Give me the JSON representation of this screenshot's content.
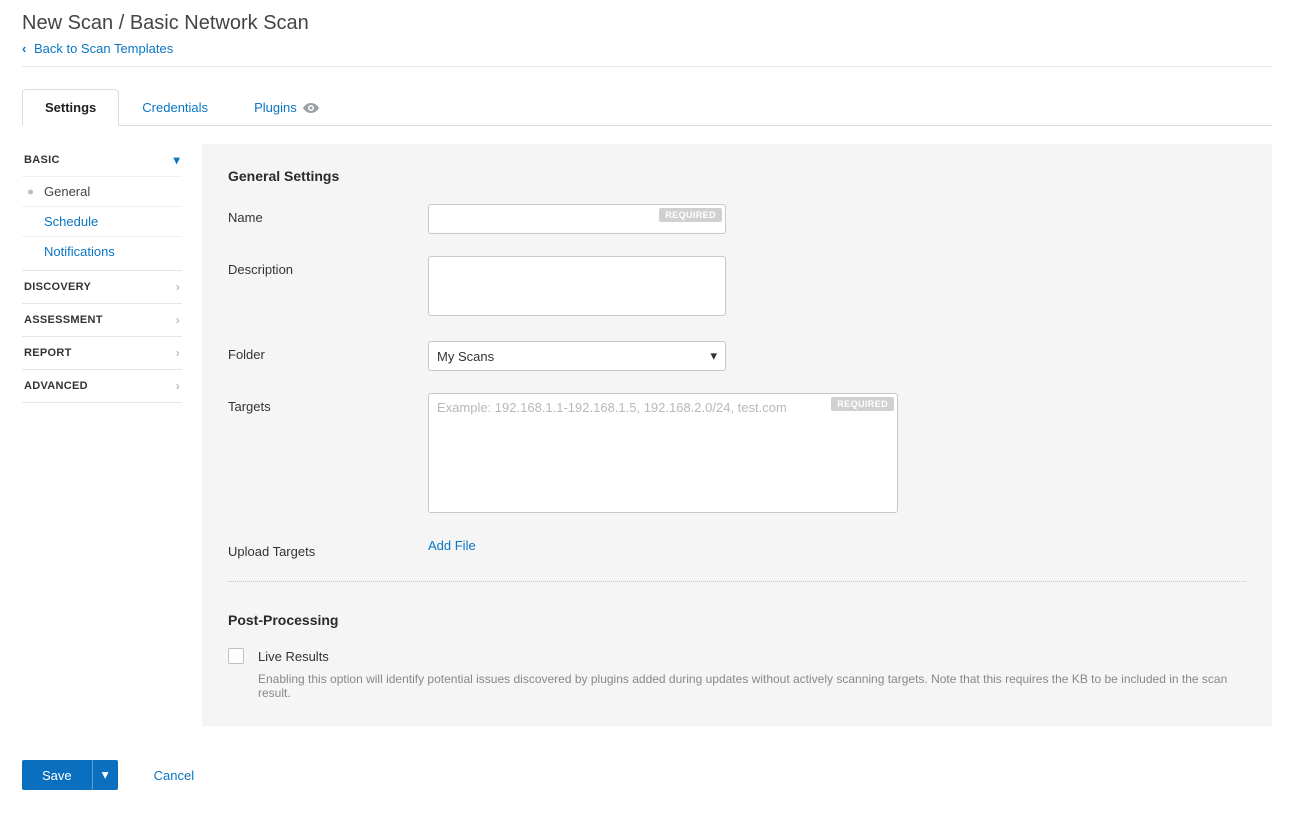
{
  "header": {
    "title": "New Scan / Basic Network Scan",
    "back_label": "Back to Scan Templates"
  },
  "tabs": {
    "settings": "Settings",
    "credentials": "Credentials",
    "plugins": "Plugins"
  },
  "sidebar": {
    "basic": {
      "label": "BASIC",
      "items": {
        "general": "General",
        "schedule": "Schedule",
        "notifications": "Notifications"
      }
    },
    "discovery": "DISCOVERY",
    "assessment": "ASSESSMENT",
    "report": "REPORT",
    "advanced": "ADVANCED"
  },
  "form": {
    "general_title": "General Settings",
    "name_label": "Name",
    "description_label": "Description",
    "folder_label": "Folder",
    "folder_value": "My Scans",
    "targets_label": "Targets",
    "targets_placeholder": "Example: 192.168.1.1-192.168.1.5, 192.168.2.0/24, test.com",
    "upload_label": "Upload Targets",
    "add_file": "Add File",
    "required_tag": "REQUIRED",
    "post_title": "Post-Processing",
    "live_results": "Live Results",
    "live_help": "Enabling this option will identify potential issues discovered by plugins added during updates without actively scanning targets. Note that this requires the KB to be included in the scan result."
  },
  "footer": {
    "save": "Save",
    "cancel": "Cancel"
  }
}
